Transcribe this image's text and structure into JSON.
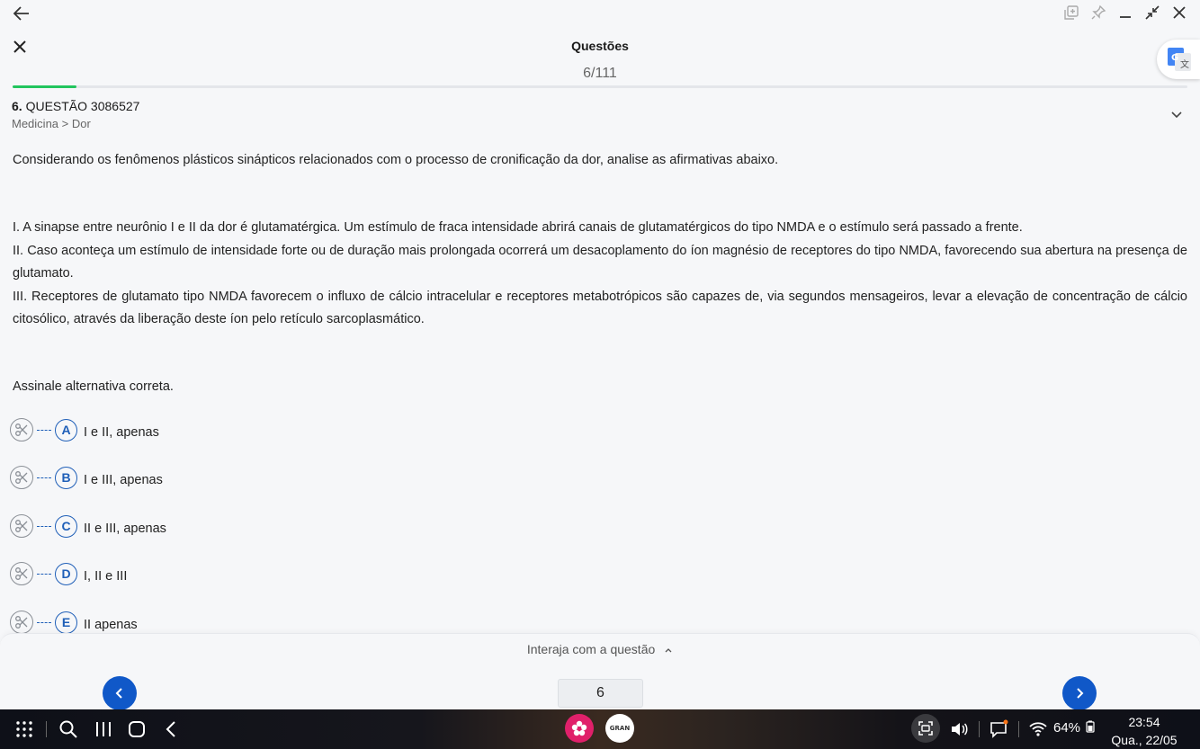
{
  "window": {
    "title": "Questões",
    "counter": "6/111",
    "progress_fraction": 0.054
  },
  "question": {
    "number_prefix": "6.",
    "label": "QUESTÃO 3086527",
    "breadcrumb": "Medicina > Dor",
    "intro": "Considerando os fenômenos plásticos sinápticos relacionados com o processo de cronificação da dor, analise as afirmativas abaixo.",
    "statements": [
      "I. A sinapse entre neurônio I e II da dor é glutamatérgica. Um estímulo de fraca intensidade abrirá canais de glutamatérgicos do tipo NMDA e o estímulo será passado a frente.",
      "II. Caso aconteça um estímulo de intensidade forte ou de duração mais prolongada ocorrerá um desacoplamento do íon magnésio de receptores do tipo NMDA, favorecendo sua abertura na presença de glutamato.",
      "III. Receptores de glutamato tipo NMDA favorecem o influxo de cálcio intracelular e receptores metabotrópicos são capazes de, via segundos mensageiros, levar a elevação de concentração de cálcio citosólico, através da liberação deste íon pelo retículo sarcoplasmático."
    ],
    "ask": "Assinale alternativa correta.",
    "options": [
      {
        "letter": "A",
        "text": "I e II, apenas"
      },
      {
        "letter": "B",
        "text": "I e III, apenas"
      },
      {
        "letter": "C",
        "text": "II e III, apenas"
      },
      {
        "letter": "D",
        "text": "I, II e III"
      },
      {
        "letter": "E",
        "text": "II apenas"
      }
    ]
  },
  "bottom": {
    "interact_label": "Interaja com a questão",
    "page_input_value": "6"
  },
  "taskbar": {
    "battery": "64%",
    "time": "23:54",
    "date": "Qua., 22/05",
    "gran_label": "GRAN"
  },
  "colors": {
    "accent_blue": "#1058c8",
    "progress_green": "#22c55e",
    "option_blue": "#1f5fb8"
  }
}
